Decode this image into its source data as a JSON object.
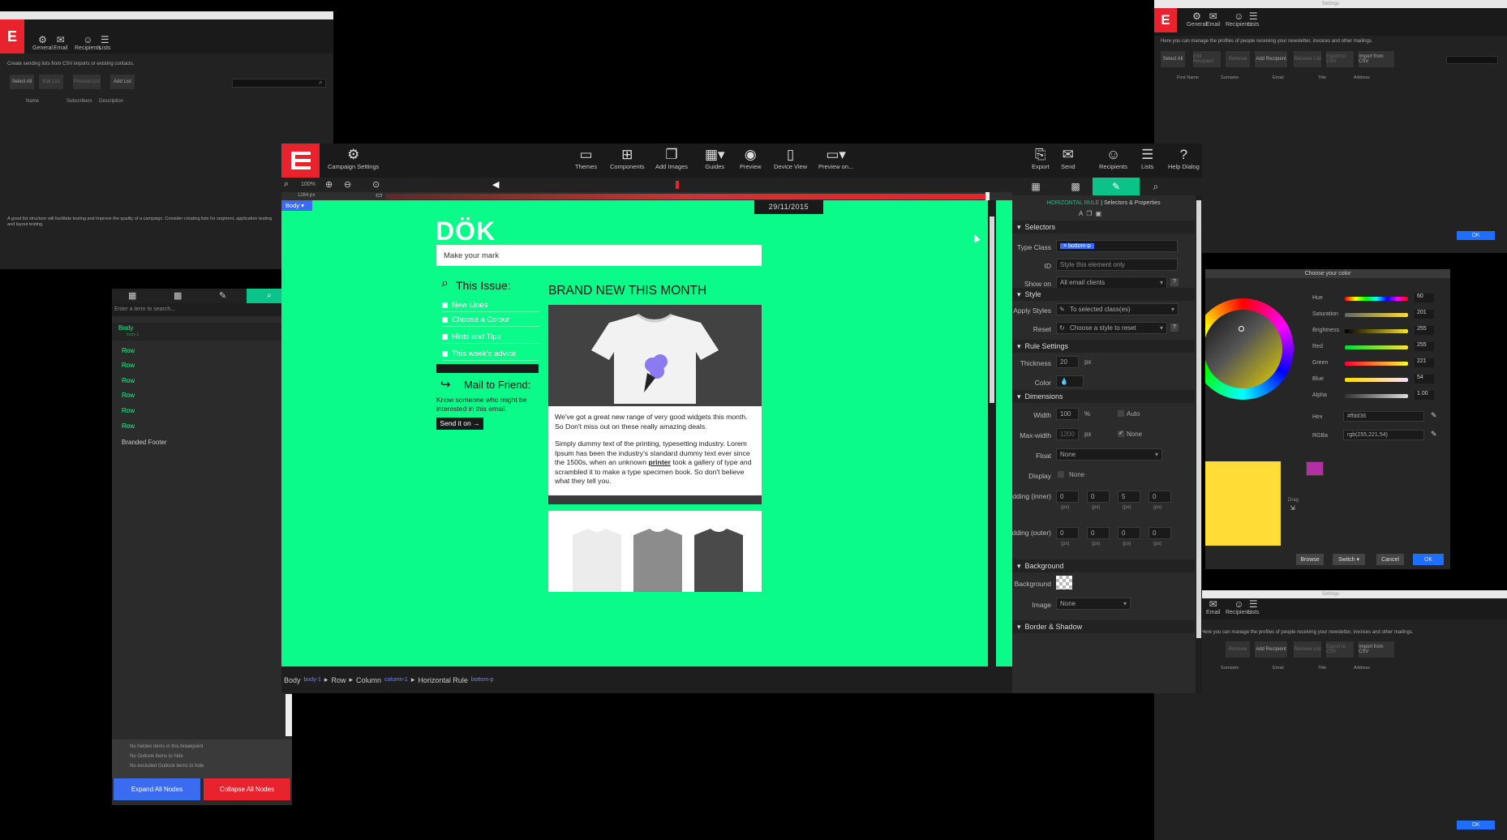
{
  "main_toolbar": {
    "campaign_settings": "Campaign Settings",
    "themes": "Themes",
    "components": "Components",
    "add_images": "Add Images",
    "guides": "Guides",
    "preview": "Preview",
    "device_view": "Device View",
    "preview_on": "Preview on...",
    "export": "Export",
    "send": "Send",
    "recipients": "Recipients",
    "lists": "Lists",
    "help_dialog": "Help Dialog"
  },
  "zoom": {
    "level": "100%",
    "ruler_width": "1284 px"
  },
  "canvas": {
    "body_tag": "Body",
    "date": "29/11/2015",
    "logo": "DÖK",
    "tagline": "Make your mark",
    "issue_title": "This Issue:",
    "issue_items": [
      "New Lines",
      "Choose a Colour",
      "Hints and Tips",
      "This week's advice"
    ],
    "mail_title": "Mail to Friend:",
    "mail_text": "Know someone who might be interested in this email.",
    "send_btn": "Send it on →",
    "brand_title": "BRAND NEW THIS MONTH",
    "para1": "We've got a great new range of very good widgets this month. So Don't miss out on these really amazing deals.",
    "para2_a": "Simply dummy text of the printing, typesetting industry. Lorem Ipsum has been the industry's standard dummy text ever since the 1500s, when an unknown ",
    "para2_link": "printer",
    "para2_b": " took a gallery of type and scrambled it to make a type specimen book. So don't believe what they tell you."
  },
  "breadcrumbs": {
    "body": "Body",
    "body_sub": "body-1",
    "row": "Row",
    "column": "Column",
    "column_sub": "column-1",
    "hr": "Horizontal Rule",
    "hr_sub": "bottom-p"
  },
  "props": {
    "header_accent": "HORIZONTAL RULE",
    "header_rest": "| Selectors & Properties",
    "selectors": "Selectors",
    "type_class_label": "Type Class",
    "type_class_value": "× bottom-p",
    "id_label": "ID",
    "id_placeholder": "Style this element only",
    "show_on_label": "Show on",
    "show_on_value": "All email clients",
    "style": "Style",
    "apply_styles_label": "Apply Styles",
    "apply_styles_value": "To selected class(es)",
    "reset_label": "Reset",
    "reset_value": "Choose a style to reset",
    "rule_settings": "Rule Settings",
    "thickness_label": "Thickness",
    "thickness_value": "20",
    "px": "px",
    "color_label": "Color",
    "dimensions": "Dimensions",
    "width_label": "Width",
    "width_value": "100",
    "pct": "%",
    "auto": "Auto",
    "maxwidth_label": "Max-width",
    "maxwidth_value": "1200",
    "none": "None",
    "float_label": "Float",
    "float_value": "None",
    "display_label": "Display",
    "display_value": "None",
    "padding_inner_label": "Padding (inner)",
    "padding_outer_label": "Padding (outer)",
    "pad_inner": [
      "0",
      "0",
      "5",
      "0"
    ],
    "pad_outer": [
      "0",
      "0",
      "0",
      "0"
    ],
    "pad_unit": "(px)",
    "background": "Background",
    "background_label": "Background",
    "image_label": "Image",
    "image_value": "None",
    "border_shadow": "Border & Shadow"
  },
  "tree": {
    "search_placeholder": "Enter a term to search...",
    "body": "Body",
    "body_sub": "body-1",
    "rows": [
      "Row",
      "Row",
      "Row",
      "Row",
      "Row",
      "Row"
    ],
    "footer": "Branded Footer",
    "hidden1": "No hidden items in this breakpoint",
    "hidden2": "No Outlook items to hide",
    "hidden3": "No excluded Outlook items to hide",
    "expand": "Expand All Nodes",
    "collapse": "Collapse All Nodes"
  },
  "lists_window": {
    "toolbar": [
      "General",
      "Email",
      "Recipients",
      "Lists"
    ],
    "desc": "Create sending lists from CSV imports or existing contacts.",
    "buttons": [
      "Select All",
      "Edit List",
      "Preview List",
      "Add List"
    ],
    "cols": [
      "Name",
      "Subscribers",
      "Description"
    ],
    "footer": "A good list structure will facilitate testing and improve the quality of a campaign. Consider creating lists for segment, application testing and layout testing."
  },
  "recipients_window": {
    "title": "Settings",
    "toolbar": [
      "General",
      "Email",
      "Recipients",
      "Lists"
    ],
    "desc": "Here you can manage the profiles of people receiving your newsletter, invoices and other mailings.",
    "buttons": [
      "Select All",
      "Edit Recipient",
      "Remove",
      "Add Recipient",
      "Remove List",
      "Export to CSV",
      "Import from CSV"
    ],
    "cols": [
      "First Name",
      "Surname",
      "Email",
      "Title",
      "Address"
    ],
    "ok": "OK"
  },
  "color_picker": {
    "title": "Choose your color",
    "hue": "Hue",
    "hue_v": "60",
    "saturation": "Saturation",
    "saturation_v": "201",
    "brightness": "Brightness",
    "brightness_v": "255",
    "red": "Red",
    "red_v": "255",
    "green": "Green",
    "green_v": "221",
    "blue": "Blue",
    "blue_v": "54",
    "alpha": "Alpha",
    "alpha_v": "1.00",
    "hex_label": "Hex",
    "hex_v": "#ffdd36",
    "rgba_label": "RGBa",
    "rgba_v": "rgb(255,221,54)",
    "drag": "Drag",
    "browse": "Browse",
    "switch": "Switch",
    "cancel": "Cancel",
    "ok": "OK"
  }
}
